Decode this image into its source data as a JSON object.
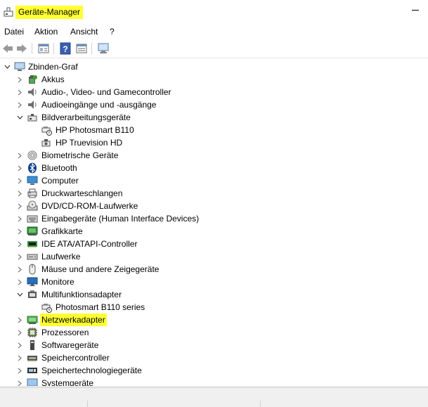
{
  "window": {
    "title": "Geräte-Manager"
  },
  "menu": [
    "Datei",
    "Aktion",
    "Ansicht",
    "?"
  ],
  "toolbar": [
    {
      "name": "back-arrow-icon"
    },
    {
      "name": "forward-arrow-icon"
    },
    {
      "name": "properties-icon"
    },
    {
      "name": "help-icon"
    },
    {
      "name": "view-icon"
    },
    {
      "name": "scan-hardware-icon"
    }
  ],
  "tree": {
    "root": "Zbinden-Graf",
    "nodes": [
      {
        "label": "Akkus",
        "icon": "battery-icon",
        "expanded": false,
        "level": 1
      },
      {
        "label": "Audio-, Video- und Gamecontroller",
        "icon": "speaker-icon",
        "expanded": false,
        "level": 1
      },
      {
        "label": "Audioeingänge und -ausgänge",
        "icon": "speaker-icon",
        "expanded": false,
        "level": 1
      },
      {
        "label": "Bildverarbeitungsgeräte",
        "icon": "imaging-device-icon",
        "expanded": true,
        "level": 1
      },
      {
        "label": "HP Photosmart B110",
        "icon": "scanner-warning-icon",
        "level": 2
      },
      {
        "label": "HP Truevision HD",
        "icon": "camera-icon",
        "level": 2
      },
      {
        "label": "Biometrische Geräte",
        "icon": "fingerprint-icon",
        "expanded": false,
        "level": 1
      },
      {
        "label": "Bluetooth",
        "icon": "bluetooth-icon",
        "expanded": false,
        "level": 1
      },
      {
        "label": "Computer",
        "icon": "computer-icon",
        "expanded": false,
        "level": 1
      },
      {
        "label": "Druckwarteschlangen",
        "icon": "printer-icon",
        "expanded": false,
        "level": 1
      },
      {
        "label": "DVD/CD-ROM-Laufwerke",
        "icon": "disc-drive-icon",
        "expanded": false,
        "level": 1
      },
      {
        "label": "Eingabegeräte (Human Interface Devices)",
        "icon": "keyboard-icon",
        "expanded": false,
        "level": 1
      },
      {
        "label": "Grafikkarte",
        "icon": "display-adapter-icon",
        "expanded": false,
        "level": 1
      },
      {
        "label": "IDE ATA/ATAPI-Controller",
        "icon": "ide-controller-icon",
        "expanded": false,
        "level": 1
      },
      {
        "label": "Laufwerke",
        "icon": "hard-drive-icon",
        "expanded": false,
        "level": 1
      },
      {
        "label": "Mäuse und andere Zeigegeräte",
        "icon": "mouse-icon",
        "expanded": false,
        "level": 1
      },
      {
        "label": "Monitore",
        "icon": "monitor-icon",
        "expanded": false,
        "level": 1
      },
      {
        "label": "Multifunktionsadapter",
        "icon": "multifunction-icon",
        "expanded": true,
        "level": 1
      },
      {
        "label": "Photosmart B110 series",
        "icon": "scanner-warning-icon",
        "level": 2
      },
      {
        "label": "Netzwerkadapter",
        "icon": "network-adapter-icon",
        "expanded": false,
        "level": 1,
        "highlight": true
      },
      {
        "label": "Prozessoren",
        "icon": "processor-icon",
        "expanded": false,
        "level": 1
      },
      {
        "label": "Softwaregeräte",
        "icon": "software-device-icon",
        "expanded": false,
        "level": 1
      },
      {
        "label": "Speichercontroller",
        "icon": "storage-controller-icon",
        "expanded": false,
        "level": 1
      },
      {
        "label": "Speichertechnologiegeräte",
        "icon": "storage-tech-icon",
        "expanded": false,
        "level": 1
      },
      {
        "label": "Systemgeräte",
        "icon": "system-device-icon",
        "expanded": false,
        "level": 1
      }
    ]
  },
  "colors": {
    "highlight": "#ffff33",
    "blue": "#2a6ebb",
    "green": "#3f9b2a"
  }
}
